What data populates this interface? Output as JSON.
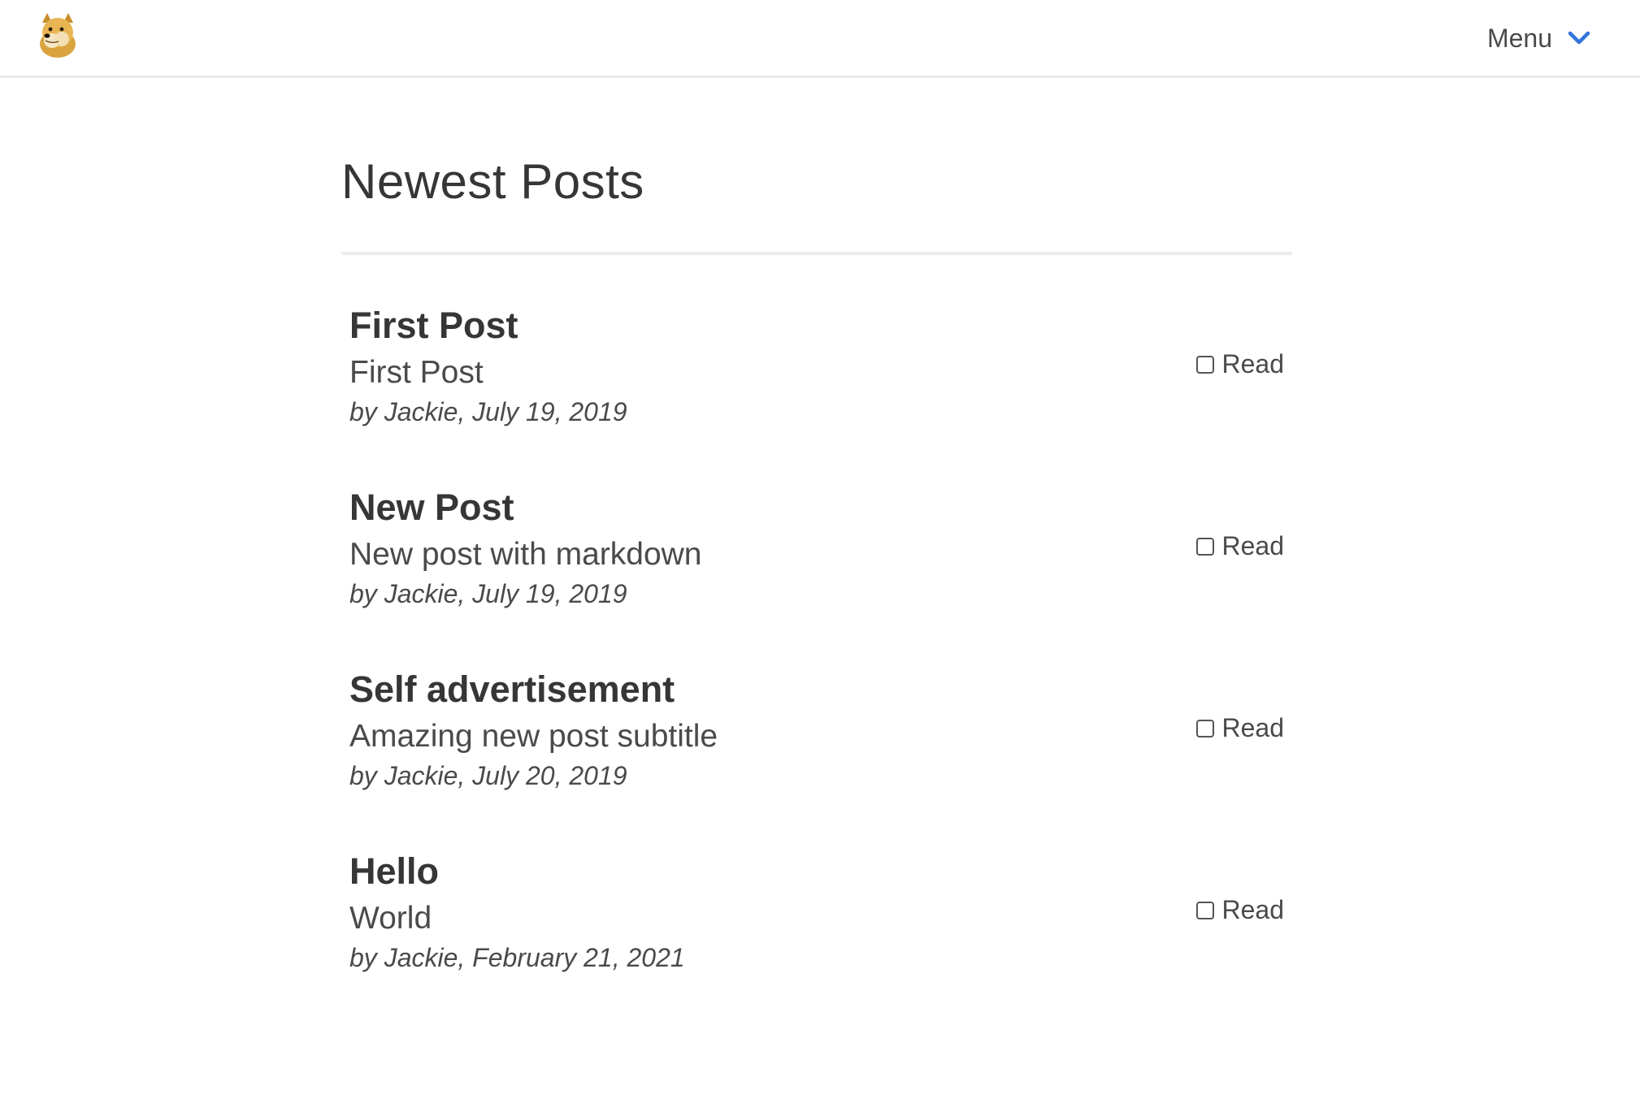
{
  "nav": {
    "logo_icon": "doge-logo-icon",
    "menu_label": "Menu",
    "menu_icon": "chevron-down-icon",
    "accent_color": "#3273dc"
  },
  "main": {
    "page_title": "Newest Posts",
    "posts": [
      {
        "title": "First Post",
        "subtitle": "First Post",
        "meta": "by Jackie, July 19, 2019",
        "read_label": "Read",
        "read_checked": false
      },
      {
        "title": "New Post",
        "subtitle": "New post with markdown",
        "meta": "by Jackie, July 19, 2019",
        "read_label": "Read",
        "read_checked": false
      },
      {
        "title": "Self advertisement",
        "subtitle": "Amazing new post subtitle",
        "meta": "by Jackie, July 20, 2019",
        "read_label": "Read",
        "read_checked": false
      },
      {
        "title": "Hello",
        "subtitle": "World",
        "meta": "by Jackie, February 21, 2021",
        "read_label": "Read",
        "read_checked": false
      }
    ]
  }
}
